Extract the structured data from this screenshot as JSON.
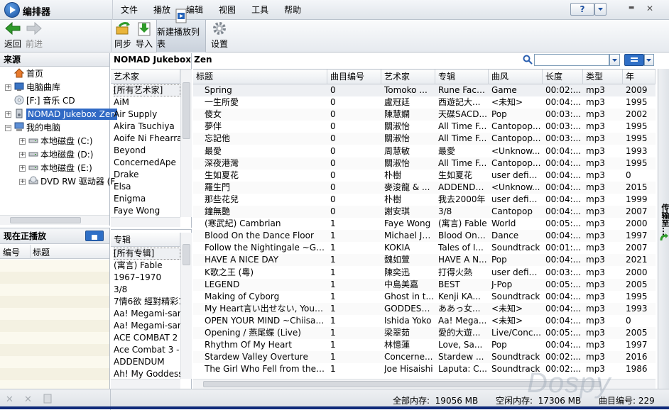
{
  "app": {
    "title": "编排器"
  },
  "menu": [
    "文件",
    "播放",
    "编辑",
    "视图",
    "工具",
    "帮助"
  ],
  "window_controls": {
    "help": "?",
    "minimize": "▬",
    "close": "✕"
  },
  "toolbar": {
    "back": "返回",
    "forward": "前进",
    "sync": "同步",
    "import": "导入",
    "new_playlist": "新建播放列表",
    "settings": "设置"
  },
  "sources": {
    "header": "来源",
    "items": [
      {
        "label": "首页"
      },
      {
        "label": "电脑曲库"
      },
      {
        "label": "[F:] 音乐 CD"
      },
      {
        "label": "NOMAD Jukebox Zen"
      },
      {
        "label": "我的电脑"
      },
      {
        "label": "本地磁盘 (C:)"
      },
      {
        "label": "本地磁盘 (D:)"
      },
      {
        "label": "本地磁盘 (E:)"
      },
      {
        "label": "DVD RW 驱动器 (F"
      }
    ]
  },
  "now_playing": {
    "header": "现在正播放",
    "col_number": "编号",
    "col_title": "标题"
  },
  "device": {
    "name": "NOMAD Jukebox Zen"
  },
  "artists": {
    "header": "艺术家",
    "items": [
      "[所有艺术家]",
      "AiM",
      "Air Supply",
      "Akira Tsuchiya",
      "Aoife Ni Fhearraig",
      "Beyond",
      "ConcernedApe",
      "Drake",
      "Elsa",
      "Enigma",
      "Faye Wong"
    ]
  },
  "albums": {
    "header": "专辑",
    "items": [
      "[所有专辑]",
      "(寓言) Fable",
      "1967–1970",
      "3/8",
      "7情6欲 經對精彩1",
      "Aa! Megami-sama",
      "Aa! Megami-sama",
      "ACE COMBAT 2 .",
      "Ace Combat 3 - E",
      "ADDENDUM",
      "Ah! My Goddess:"
    ]
  },
  "tracks": {
    "columns": [
      "标题",
      "曲目编号",
      "艺术家",
      "专辑",
      "曲风",
      "长度",
      "类型",
      "年"
    ],
    "rows": [
      [
        "Spring",
        "0",
        "Tomoko ...",
        "Rune Fact...",
        "Game",
        "00:02:...",
        "mp3",
        "2009"
      ],
      [
        "一生所愛",
        "0",
        "盧冠廷",
        "西遊記大...",
        "<未知>",
        "00:04:...",
        "mp3",
        "1995"
      ],
      [
        "傻女",
        "0",
        "陳慧嫻",
        "天碟SACD...",
        "Pop",
        "00:03:...",
        "mp3",
        "2002"
      ],
      [
        "夢伴",
        "0",
        "關淑怡",
        "All Time F...",
        "Cantopop...",
        "00:03:...",
        "mp3",
        "1995"
      ],
      [
        "忘記他",
        "0",
        "關淑怡",
        "All Time F...",
        "Cantopop...",
        "00:03:...",
        "mp3",
        "1995"
      ],
      [
        "最愛",
        "0",
        "周慧敏",
        "最愛",
        "<Unknow...",
        "00:04:...",
        "mp3",
        "1993"
      ],
      [
        "深夜港灣",
        "0",
        "關淑怡",
        "All Time F...",
        "Cantopop...",
        "00:04:...",
        "mp3",
        "1995"
      ],
      [
        "生如夏花",
        "0",
        "朴樹",
        "生如夏花",
        "user defined",
        "00:04:...",
        "mp3",
        "0"
      ],
      [
        "羅生門",
        "0",
        "麥浚龍 & ...",
        "ADDENDUM",
        "<Unknow...",
        "00:04:...",
        "mp3",
        "2015"
      ],
      [
        "那些花兒",
        "0",
        "朴樹",
        "我去2000年",
        "user defined",
        "00:04:...",
        "mp3",
        "1999"
      ],
      [
        "鐘無艷",
        "0",
        "謝安琪",
        "3/8",
        "Cantopop",
        "00:04:...",
        "mp3",
        "2007"
      ],
      [
        "(寒武紀) Cambrian",
        "1",
        "Faye Wong",
        "(寓言) Fable",
        "World",
        "00:05:...",
        "mp3",
        "2000"
      ],
      [
        "Blood On the Dance Floor",
        "1",
        "Michael Ja...",
        "Blood On ...",
        "Dance",
        "00:04:...",
        "mp3",
        "1997"
      ],
      [
        "Follow the Nightingale ~Game...",
        "1",
        "KOKIA",
        "Tales of I...",
        "Soundtrack",
        "00:01:...",
        "mp3",
        "2007"
      ],
      [
        "HAVE A NICE DAY",
        "1",
        "魏如萱",
        "HAVE A N...",
        "Pop",
        "00:04:...",
        "mp3",
        "2021"
      ],
      [
        "K歌之王 (粵)",
        "1",
        "陳奕迅",
        "打得火熱",
        "user defined",
        "00:03:...",
        "mp3",
        "2000"
      ],
      [
        "LEGEND",
        "1",
        "中島美嘉",
        "BEST",
        "J-Pop",
        "00:05:...",
        "mp3",
        "2005"
      ],
      [
        "Making of Cyborg",
        "1",
        "Ghost in t...",
        "Kenji KA...",
        "Soundtrack",
        "00:04:...",
        "mp3",
        "1995"
      ],
      [
        "My Heart言い出せない, Your H...",
        "1",
        "GODDESS...",
        "ああっ女...",
        "<未知>",
        "00:04:...",
        "mp3",
        "1993"
      ],
      [
        "OPEN YOUR MIND ~Chiisana H...",
        "1",
        "Ishida Yoko",
        "Aa! Mega...",
        "<未知>",
        "00:04:...",
        "mp3",
        "0"
      ],
      [
        "Opening / 燕尾蝶 (Live)",
        "1",
        "梁翠茹",
        "愛的大遊...",
        "Live/Conc...",
        "00:05:...",
        "mp3",
        "2005"
      ],
      [
        "Rhythm Of My Heart",
        "1",
        "林憶蓮",
        "Love, Sa...",
        "Pop",
        "00:04:...",
        "mp3",
        "1997"
      ],
      [
        "Stardew Valley Overture",
        "1",
        "Concerne...",
        "Stardew ...",
        "Soundtrack",
        "00:02:...",
        "mp3",
        "2016"
      ],
      [
        "The Girl Who Fell from the Sky",
        "1",
        "Joe Hisaishi",
        "Laputa: C...",
        "Soundtrack",
        "00:02:...",
        "mp3",
        "1986"
      ]
    ]
  },
  "status": {
    "total_memory": "全部内存:  19056 MB",
    "free_memory": "空闲内存:  17306 MB",
    "track_count": "曲目编号: 229"
  },
  "side_tab": {
    "label": "传输至..."
  },
  "watermark": "Dospy"
}
